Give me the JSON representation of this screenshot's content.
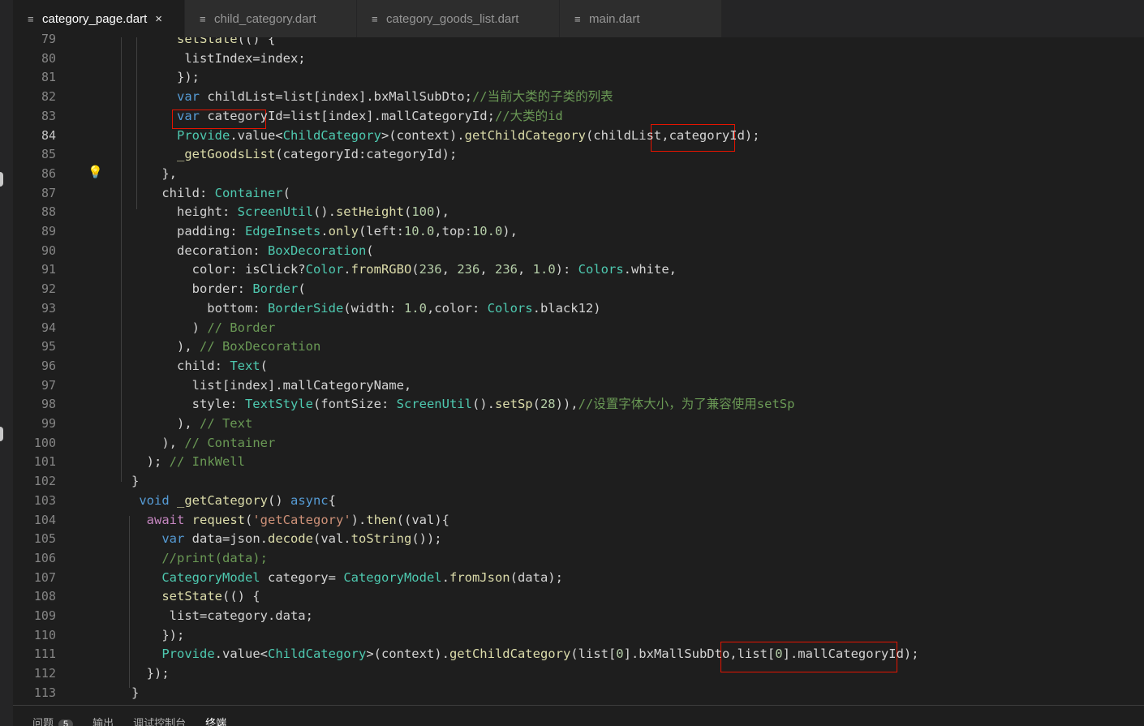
{
  "tabs": [
    {
      "label": "category_page.dart",
      "active": true,
      "close": "×"
    },
    {
      "label": "child_category.dart",
      "active": false
    },
    {
      "label": "category_goods_list.dart",
      "active": false
    },
    {
      "label": "main.dart",
      "active": false
    }
  ],
  "current_line": "84",
  "lines": [
    {
      "num": "79",
      "text": "            setState(() {"
    },
    {
      "num": "80",
      "text": "             listIndex=index;"
    },
    {
      "num": "81",
      "text": "            });"
    },
    {
      "num": "82",
      "text": "            var childList=list[index].bxMallSubDto;//当前大类的子类的列表"
    },
    {
      "num": "83",
      "text": "            var categoryId=list[index].mallCategoryId;//大类的id"
    },
    {
      "num": "84",
      "text": "            Provide.value<ChildCategory>(context).getChildCategory(childList,categoryId);"
    },
    {
      "num": "85",
      "text": "            _getGoodsList(categoryId:categoryId);"
    },
    {
      "num": "86",
      "text": "          },"
    },
    {
      "num": "87",
      "text": "          child: Container("
    },
    {
      "num": "88",
      "text": "            height: ScreenUtil().setHeight(100),"
    },
    {
      "num": "89",
      "text": "            padding: EdgeInsets.only(left:10.0,top:10.0),"
    },
    {
      "num": "90",
      "text": "            decoration: BoxDecoration("
    },
    {
      "num": "91",
      "text": "              color: isClick?Color.fromRGBO(236, 236, 236, 1.0): Colors.white,"
    },
    {
      "num": "92",
      "text": "              border: Border("
    },
    {
      "num": "93",
      "text": "                bottom: BorderSide(width: 1.0,color: Colors.black12)"
    },
    {
      "num": "94",
      "text": "              ) // Border"
    },
    {
      "num": "95",
      "text": "            ), // BoxDecoration"
    },
    {
      "num": "96",
      "text": "            child: Text("
    },
    {
      "num": "97",
      "text": "              list[index].mallCategoryName,"
    },
    {
      "num": "98",
      "text": "              style: TextStyle(fontSize: ScreenUtil().setSp(28)),//设置字体大小，为了兼容使用setSp"
    },
    {
      "num": "99",
      "text": "            ), // Text"
    },
    {
      "num": "100",
      "text": "          ), // Container"
    },
    {
      "num": "101",
      "text": "        ); // InkWell"
    },
    {
      "num": "102",
      "text": "      }"
    },
    {
      "num": "103",
      "text": "       void _getCategory() async{"
    },
    {
      "num": "104",
      "text": "        await request('getCategory').then((val){"
    },
    {
      "num": "105",
      "text": "          var data=json.decode(val.toString());"
    },
    {
      "num": "106",
      "text": "          //print(data);"
    },
    {
      "num": "107",
      "text": "          CategoryModel category= CategoryModel.fromJson(data);"
    },
    {
      "num": "108",
      "text": "          setState(() {"
    },
    {
      "num": "109",
      "text": "           list=category.data;"
    },
    {
      "num": "110",
      "text": "          });"
    },
    {
      "num": "111",
      "text": "          Provide.value<ChildCategory>(context).getChildCategory(list[0].bxMallSubDto,list[0].mallCategoryId);"
    },
    {
      "num": "112",
      "text": "        });"
    },
    {
      "num": "113",
      "text": "      }"
    }
  ],
  "panel": {
    "tabs": [
      "问题",
      "输出",
      "调试控制台",
      "终端"
    ],
    "problems_count": "5"
  }
}
